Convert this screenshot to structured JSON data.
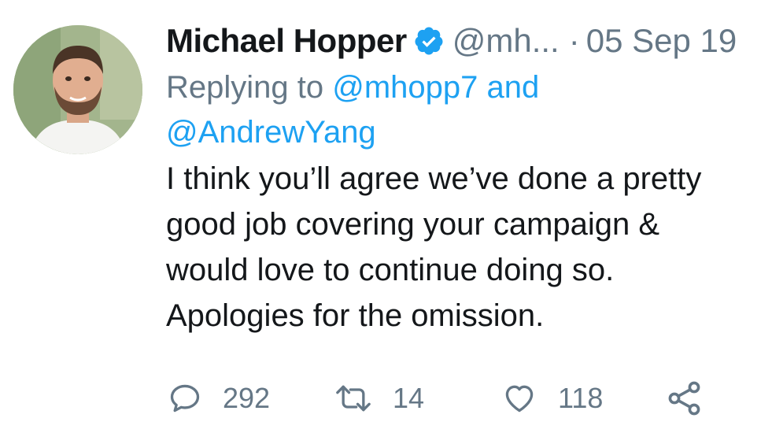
{
  "tweet": {
    "author_name": "Michael Hopper",
    "verified_icon": "verified-badge-icon",
    "handle": "@mh...",
    "separator": "·",
    "date": "05 Sep 19",
    "reply_prefix": "Replying to",
    "reply_mention_1": "@mhopp7",
    "reply_conjunction": "and",
    "reply_mention_2": "@AndrewYang",
    "text_lines": [
      "I think you’ll agree we’ve done a pretty",
      "good job covering your campaign &",
      "would love to continue doing so.",
      "Apologies for the omission."
    ]
  },
  "actions": {
    "reply_count": "292",
    "retweet_count": "14",
    "like_count": "118"
  },
  "colors": {
    "accent": "#1da1f2",
    "muted": "#657786",
    "text": "#14171a"
  }
}
